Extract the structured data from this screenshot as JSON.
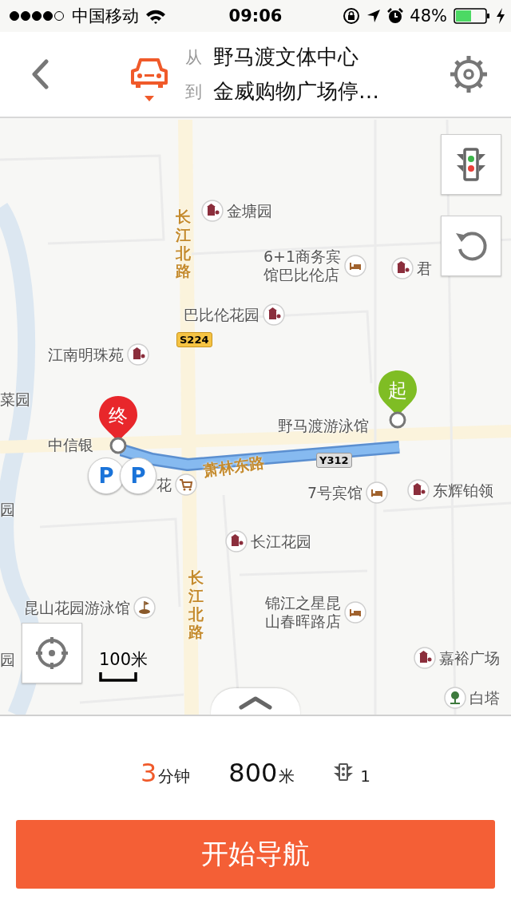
{
  "status_bar": {
    "carrier": "中国移动",
    "time": "09:06",
    "battery": "48%"
  },
  "header": {
    "from_label": "从",
    "from": "野马渡文体中心",
    "to_label": "到",
    "to": "金威购物广场停…"
  },
  "map": {
    "labels": [
      {
        "lines": [
          "金塘园"
        ]
      },
      {
        "lines": [
          "6+1商务宾",
          "馆巴比伦店"
        ]
      },
      {
        "lines": [
          "君"
        ]
      },
      {
        "lines": [
          "巴比伦花园"
        ]
      },
      {
        "lines": [
          "江南明珠苑"
        ]
      },
      {
        "lines": [
          "菜园"
        ]
      },
      {
        "lines": [
          "野马渡游泳馆"
        ]
      },
      {
        "lines": [
          "中信银"
        ]
      },
      {
        "lines": [
          "花"
        ]
      },
      {
        "lines": [
          "7号宾馆"
        ]
      },
      {
        "lines": [
          "东辉铂领"
        ]
      },
      {
        "lines": [
          "园"
        ]
      },
      {
        "lines": [
          "长江花园"
        ]
      },
      {
        "lines": [
          "昆山花园游泳馆"
        ]
      },
      {
        "lines": [
          "锦江之星昆",
          "山春晖路店"
        ]
      },
      {
        "lines": [
          "嘉裕广场"
        ]
      },
      {
        "lines": [
          "园"
        ]
      },
      {
        "lines": [
          "白塔"
        ]
      }
    ],
    "roads": [
      {
        "name": "长江北路",
        "kind": "vertical"
      },
      {
        "name": "长江北路",
        "kind": "vertical"
      },
      {
        "name": "萧林东路",
        "kind": "slanted"
      }
    ],
    "shields": [
      "S224",
      "Y312"
    ],
    "start_pin": "起",
    "end_pin": "终",
    "parking": [
      "P",
      "P"
    ],
    "scale": "100米"
  },
  "summary": {
    "time_value": "3",
    "time_unit": "分钟",
    "distance_value": "800",
    "distance_unit": "米",
    "lights": "1"
  },
  "button": "开始导航"
}
